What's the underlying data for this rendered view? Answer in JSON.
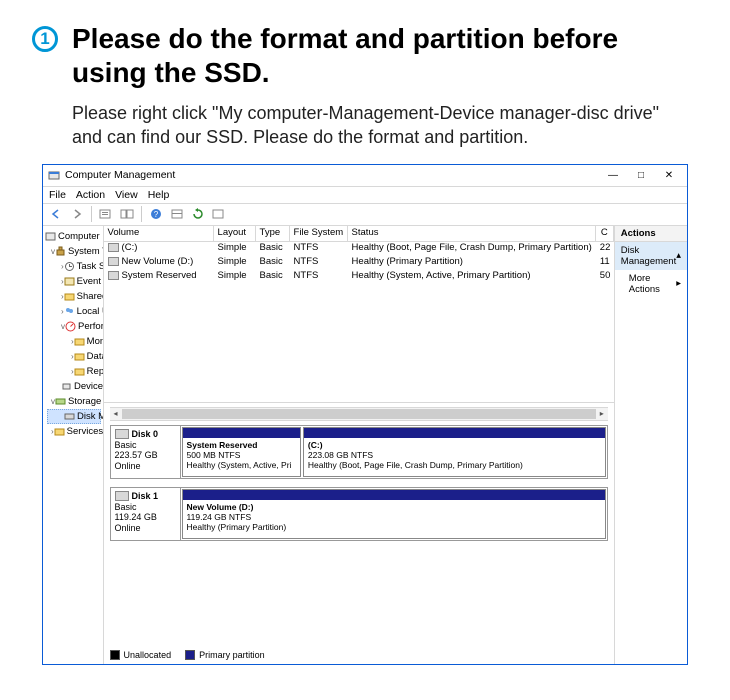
{
  "header": {
    "bullet": "1",
    "title": "Please do the format and partition before using the SSD.",
    "desc": "Please right click \"My computer-Management-Device manager-disc drive\" and can find our SSD. Please do the format and partition."
  },
  "window": {
    "title": "Computer Management",
    "min": "—",
    "max": "□",
    "close": "✕"
  },
  "menu": {
    "file": "File",
    "action": "Action",
    "view": "View",
    "help": "Help"
  },
  "tree": {
    "root": "Computer Management (Local",
    "systools": "System Tools",
    "task": "Task Scheduler",
    "event": "Event Viewer",
    "shared": "Shared Folders",
    "users": "Local Users and Groups",
    "perf": "Performance",
    "montools": "Monitoring Tools",
    "datacol": "Data Collector Sets",
    "reports": "Reports",
    "devmgr": "Device Manager",
    "storage": "Storage",
    "diskmgmt": "Disk Management",
    "services": "Services and Applications"
  },
  "cols": {
    "volume": "Volume",
    "layout": "Layout",
    "type": "Type",
    "fs": "File System",
    "status": "Status",
    "cap": "C"
  },
  "rows": [
    {
      "vol": "(C:)",
      "layout": "Simple",
      "type": "Basic",
      "fs": "NTFS",
      "status": "Healthy (Boot, Page File, Crash Dump, Primary Partition)",
      "cap": "22"
    },
    {
      "vol": "New Volume (D:)",
      "layout": "Simple",
      "type": "Basic",
      "fs": "NTFS",
      "status": "Healthy (Primary Partition)",
      "cap": "11"
    },
    {
      "vol": "System Reserved",
      "layout": "Simple",
      "type": "Basic",
      "fs": "NTFS",
      "status": "Healthy (System, Active, Primary Partition)",
      "cap": "50"
    }
  ],
  "disk0": {
    "label": "Disk 0",
    "type": "Basic",
    "size": "223.57 GB",
    "state": "Online",
    "p1": {
      "name": "System Reserved",
      "size": "500 MB NTFS",
      "status": "Healthy (System, Active, Pri"
    },
    "p2": {
      "name": "(C:)",
      "size": "223.08 GB NTFS",
      "status": "Healthy (Boot, Page File, Crash Dump, Primary Partition)"
    }
  },
  "disk1": {
    "label": "Disk 1",
    "type": "Basic",
    "size": "119.24 GB",
    "state": "Online",
    "p1": {
      "name": "New Volume  (D:)",
      "size": "119.24 GB NTFS",
      "status": "Healthy (Primary Partition)"
    }
  },
  "legend": {
    "unalloc": "Unallocated",
    "primary": "Primary partition"
  },
  "actions": {
    "header": "Actions",
    "diskmgmt": "Disk Management",
    "more": "More Actions",
    "arrowup": "▴",
    "arrowright": "▸"
  }
}
